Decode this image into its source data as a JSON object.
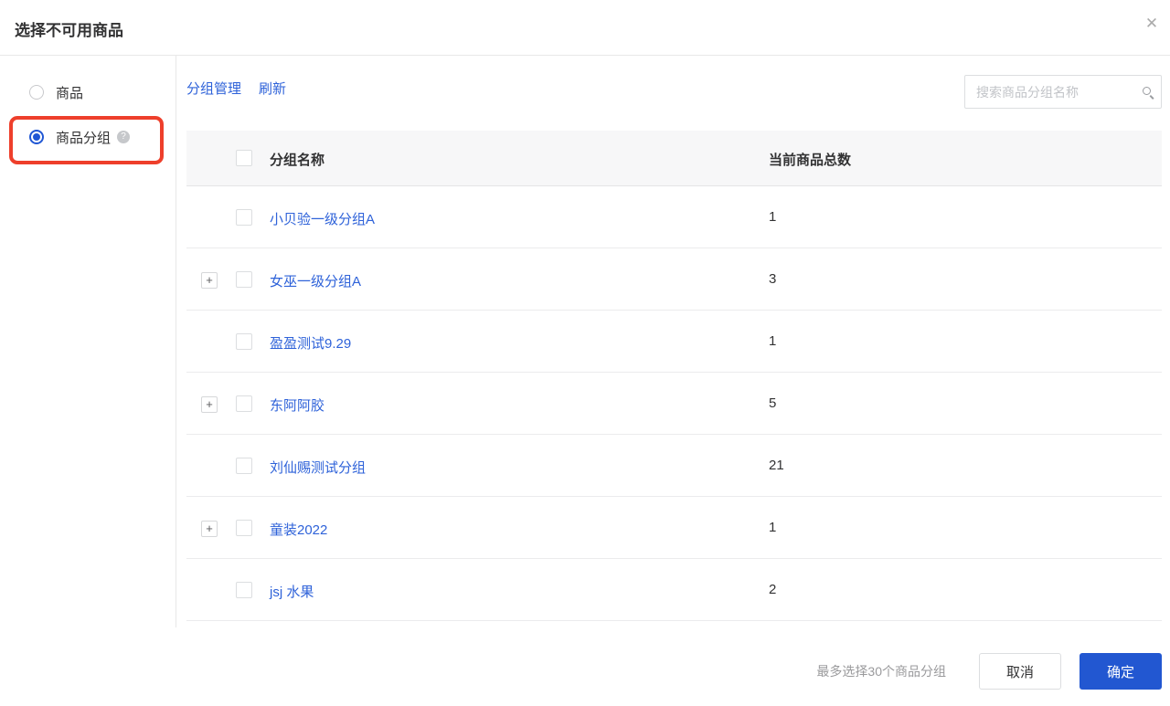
{
  "dialog": {
    "title": "选择不可用商品",
    "close_icon": "✕"
  },
  "sidebar": {
    "options": [
      {
        "label": "商品",
        "selected": false
      },
      {
        "label": "商品分组",
        "selected": true,
        "help_icon": "?",
        "annotated": true
      }
    ],
    "annotation_color": "#ee3f2b"
  },
  "toolbar": {
    "manage_link": "分组管理",
    "refresh_link": "刷新",
    "search_placeholder": "搜索商品分组名称",
    "search_icon": "magnifier"
  },
  "table": {
    "columns": {
      "name": "分组名称",
      "count": "当前商品总数"
    },
    "expander_symbol": "+",
    "rows": [
      {
        "name": "小贝验一级分组A",
        "count": "1",
        "expandable": false
      },
      {
        "name": "女巫一级分组A",
        "count": "3",
        "expandable": true
      },
      {
        "name": "盈盈测试9.29",
        "count": "1",
        "expandable": false
      },
      {
        "name": "东阿阿胶",
        "count": "5",
        "expandable": true
      },
      {
        "name": "刘仙赐测试分组",
        "count": "21",
        "expandable": false
      },
      {
        "name": "童装2022",
        "count": "1",
        "expandable": true
      },
      {
        "name": "jsj 水果",
        "count": "2",
        "expandable": false
      }
    ]
  },
  "footer": {
    "hint": "最多选择30个商品分组",
    "cancel_label": "取消",
    "confirm_label": "确定"
  },
  "colors": {
    "primary_blue": "#2257d1",
    "link_blue": "#2e62d9",
    "annotation_red": "#ee3f2b",
    "header_bg": "#f7f7f8"
  }
}
